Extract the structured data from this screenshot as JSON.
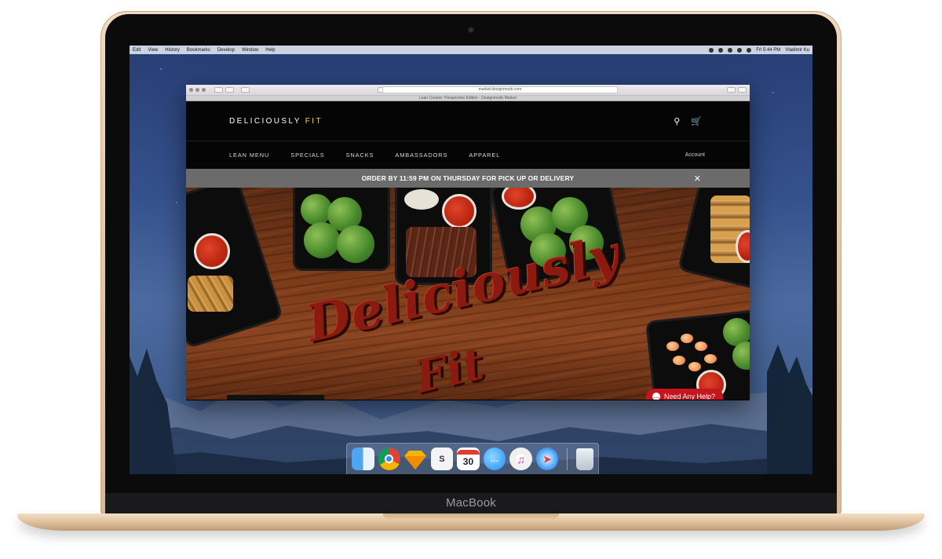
{
  "device": {
    "label": "MacBook"
  },
  "menubar": {
    "items": [
      "Edit",
      "View",
      "History",
      "Bookmarks",
      "Develop",
      "Window",
      "Help"
    ],
    "time": "Fri 5:44 PM",
    "user": "Vladimir Ku"
  },
  "browser": {
    "url": "market.designmodo.com",
    "tab_title": "Lean Creator: Perspective Edition - Designmodo Market"
  },
  "site": {
    "logo_main": "DELICIOUSLY ",
    "logo_accent": "FIT",
    "nav": [
      "LEAN MENU",
      "SPECIALS",
      "SNACKS",
      "AMBASSADORS",
      "APPAREL"
    ],
    "account": "Account",
    "announcement": "ORDER BY 11:59 PM ON THURSDAY FOR PICK UP OR DELIVERY",
    "hero_text_1": "Deliciously",
    "hero_text_2": "Fit",
    "help_button": "Need Any Help?"
  },
  "dock": {
    "apps": [
      "finder-icon",
      "chrome-icon",
      "sketch-icon",
      "slack-icon",
      "calendar-icon",
      "messages-icon",
      "itunes-icon",
      "safari-icon",
      "trash-icon"
    ],
    "calendar_day": "30"
  },
  "colors": {
    "announcement_bg": "#6b6b6b",
    "help_button": "#c4161c",
    "logo_accent": "#ffd24a"
  }
}
